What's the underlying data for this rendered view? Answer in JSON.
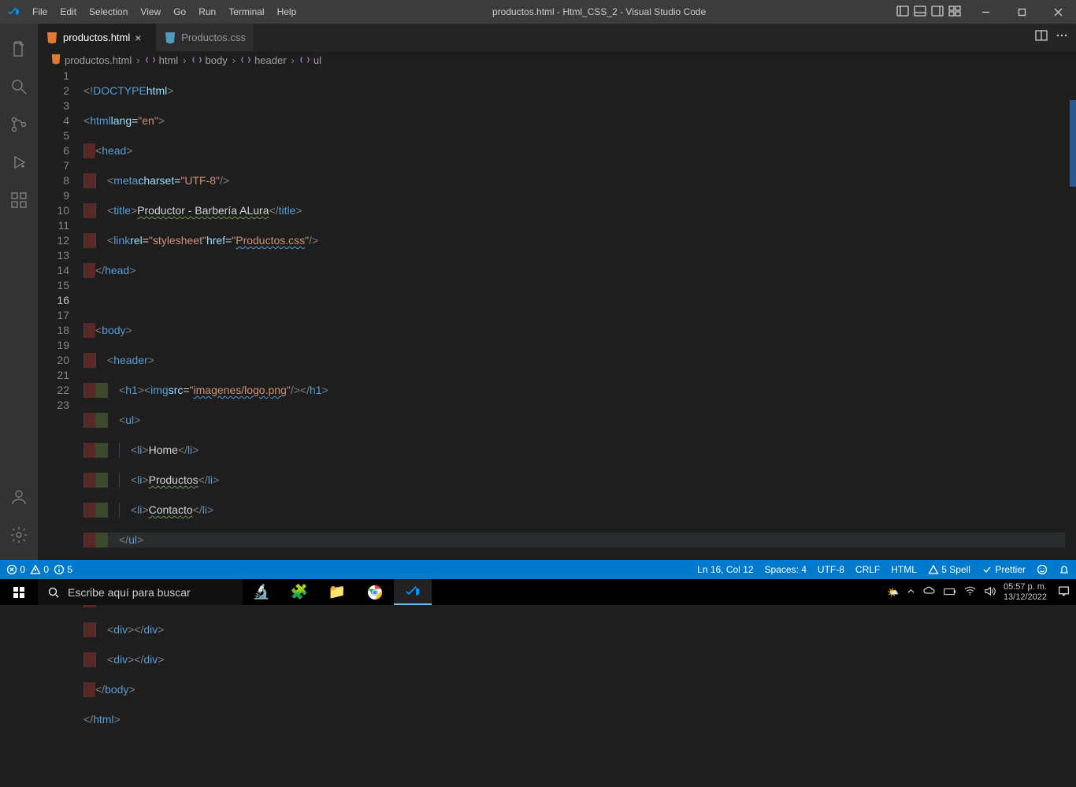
{
  "title": "productos.html - Html_CSS_2 - Visual Studio Code",
  "menu": [
    "File",
    "Edit",
    "Selection",
    "View",
    "Go",
    "Run",
    "Terminal",
    "Help"
  ],
  "tabs": [
    {
      "label": "productos.html",
      "icon": "html",
      "active": true,
      "dirty": false
    },
    {
      "label": "Productos.css",
      "icon": "css",
      "active": false,
      "dirty": false
    }
  ],
  "breadcrumbs": [
    {
      "label": "productos.html",
      "icon": "html"
    },
    {
      "label": "html",
      "icon": "sym"
    },
    {
      "label": "body",
      "icon": "sym"
    },
    {
      "label": "header",
      "icon": "sym"
    },
    {
      "label": "ul",
      "icon": "sym"
    }
  ],
  "code": {
    "lines": 23,
    "current": 16,
    "content": {
      "l5_title": "Productor - Barbería ALura",
      "l6_href": "Productos.css",
      "l11_src": "imagenes/logo.png",
      "l13_text": "Home",
      "l14_text": "Productos",
      "l15_text": "Contacto"
    }
  },
  "status": {
    "errors": "0",
    "warnings": "0",
    "info": "5",
    "pos": "Ln 16, Col 12",
    "spaces": "Spaces: 4",
    "encoding": "UTF-8",
    "eol": "CRLF",
    "lang": "HTML",
    "spell": "5 Spell",
    "prettier": "Prettier"
  },
  "taskbar": {
    "search_placeholder": "Escribe aquí para buscar",
    "time": "05:57 p. m.",
    "date": "13/12/2022"
  }
}
